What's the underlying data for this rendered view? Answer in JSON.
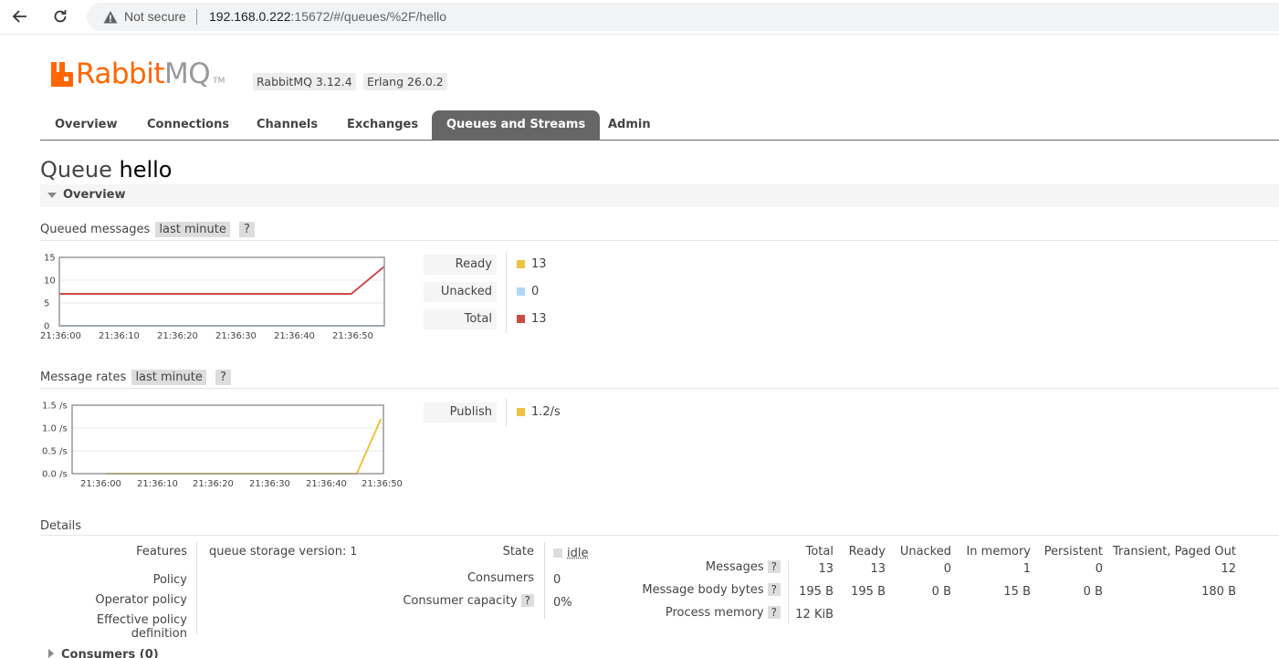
{
  "browser": {
    "security_label": "Not secure",
    "url_host": "192.168.0.222",
    "url_rest": ":15672/#/queues/%2F/hello"
  },
  "header": {
    "logo_rabbit": "Rabbit",
    "logo_mq": "MQ",
    "logo_tm": "TM",
    "version_badge": "RabbitMQ 3.12.4",
    "erlang_badge": "Erlang 26.0.2"
  },
  "tabs": [
    {
      "label": "Overview",
      "active": false
    },
    {
      "label": "Connections",
      "active": false
    },
    {
      "label": "Channels",
      "active": false
    },
    {
      "label": "Exchanges",
      "active": false
    },
    {
      "label": "Queues and Streams",
      "active": true
    },
    {
      "label": "Admin",
      "active": false
    }
  ],
  "page": {
    "title_prefix": "Queue",
    "title_name": "hello",
    "section_label": "Overview"
  },
  "queued": {
    "heading": "Queued messages",
    "range": "last minute",
    "help": "?",
    "legend": [
      {
        "label": "Ready",
        "value": "13",
        "color": "#edc240"
      },
      {
        "label": "Unacked",
        "value": "0",
        "color": "#afd8f8"
      },
      {
        "label": "Total",
        "value": "13",
        "color": "#cb4b4b"
      }
    ]
  },
  "rates": {
    "heading": "Message rates",
    "range": "last minute",
    "help": "?",
    "legend": [
      {
        "label": "Publish",
        "value": "1.2/s",
        "color": "#edc240"
      }
    ]
  },
  "chart_data": [
    {
      "type": "line",
      "x": [
        "21:36:00",
        "21:36:10",
        "21:36:20",
        "21:36:30",
        "21:36:40",
        "21:36:50"
      ],
      "yticks": [
        "15",
        "10",
        "5",
        "0"
      ],
      "ylim": [
        0,
        15
      ],
      "series": [
        {
          "name": "Total",
          "color": "#cb4b4b",
          "points": [
            [
              0,
              7
            ],
            [
              53,
              7
            ],
            [
              59,
              13
            ]
          ]
        },
        {
          "name": "Unacked",
          "color": "#afd8f8",
          "points": [
            [
              0,
              0
            ],
            [
              59,
              0
            ]
          ]
        }
      ],
      "xlim": [
        0,
        59
      ],
      "grid": true
    },
    {
      "type": "line",
      "x": [
        "21:36:00",
        "21:36:10",
        "21:36:20",
        "21:36:30",
        "21:36:40",
        "21:36:50"
      ],
      "yticks": [
        "1.5 /s",
        "1.0 /s",
        "0.5 /s",
        "0.0 /s"
      ],
      "ylim": [
        0,
        1.5
      ],
      "series": [
        {
          "name": "Publish",
          "color": "#edc240",
          "points": [
            [
              0,
              0
            ],
            [
              51.5,
              0
            ],
            [
              56.5,
              1.2
            ]
          ]
        }
      ],
      "xlim": [
        -7,
        57
      ],
      "grid": true
    }
  ],
  "details": {
    "heading": "Details",
    "features_label": "Features",
    "features_value_key": "queue storage version:",
    "features_value": "1",
    "policy_label": "Policy",
    "operator_policy_label": "Operator policy",
    "effective_policy_label": "Effective policy definition",
    "state_label": "State",
    "state_value": "idle",
    "consumers_label": "Consumers",
    "consumers_value": "0",
    "capacity_label": "Consumer capacity",
    "capacity_value": "0%",
    "help": "?",
    "columns": [
      "Total",
      "Ready",
      "Unacked",
      "In memory",
      "Persistent",
      "Transient, Paged Out"
    ],
    "rows": [
      {
        "label": "Messages",
        "values": [
          "13",
          "13",
          "0",
          "1",
          "0",
          "12"
        ]
      },
      {
        "label": "Message body bytes",
        "values": [
          "195 B",
          "195 B",
          "0 B",
          "15 B",
          "0 B",
          "180 B"
        ]
      },
      {
        "label": "Process memory",
        "values": [
          "12 KiB"
        ]
      }
    ]
  },
  "consumers_section": "Consumers (0)"
}
